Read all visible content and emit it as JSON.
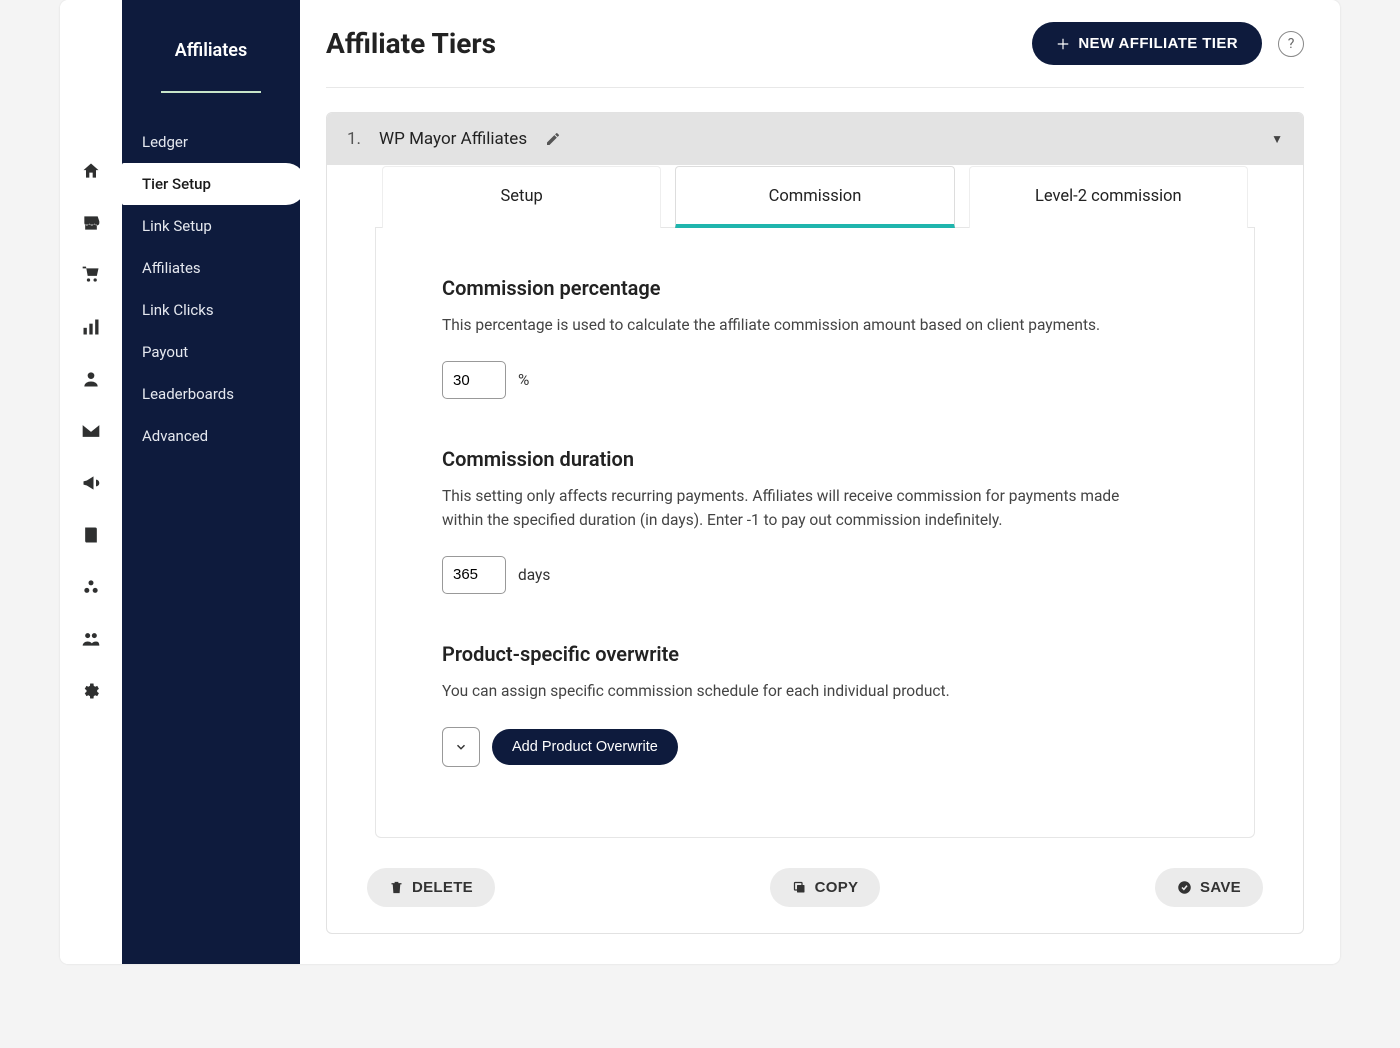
{
  "sidebar": {
    "title": "Affiliates",
    "items": [
      {
        "label": "Ledger"
      },
      {
        "label": "Tier Setup"
      },
      {
        "label": "Link Setup"
      },
      {
        "label": "Affiliates"
      },
      {
        "label": "Link Clicks"
      },
      {
        "label": "Payout"
      },
      {
        "label": "Leaderboards"
      },
      {
        "label": "Advanced"
      }
    ]
  },
  "header": {
    "title": "Affiliate Tiers",
    "new_button": "NEW AFFILIATE TIER",
    "help": "?"
  },
  "tier": {
    "number": "1.",
    "name": "WP Mayor Affiliates"
  },
  "tabs": {
    "setup": "Setup",
    "commission": "Commission",
    "level2": "Level-2 commission"
  },
  "commission": {
    "percentage": {
      "heading": "Commission percentage",
      "description": "This percentage is used to calculate the affiliate commission amount based on client payments.",
      "value": "30",
      "unit": "%"
    },
    "duration": {
      "heading": "Commission duration",
      "description": "This setting only affects recurring payments. Affiliates will receive commission for payments made within the specified duration (in days). Enter -1 to pay out commission indefinitely.",
      "value": "365",
      "unit": "days"
    },
    "overwrite": {
      "heading": "Product-specific overwrite",
      "description": "You can assign specific commission schedule for each individual product.",
      "button": "Add Product Overwrite"
    }
  },
  "footer": {
    "delete": "DELETE",
    "copy": "COPY",
    "save": "SAVE"
  }
}
